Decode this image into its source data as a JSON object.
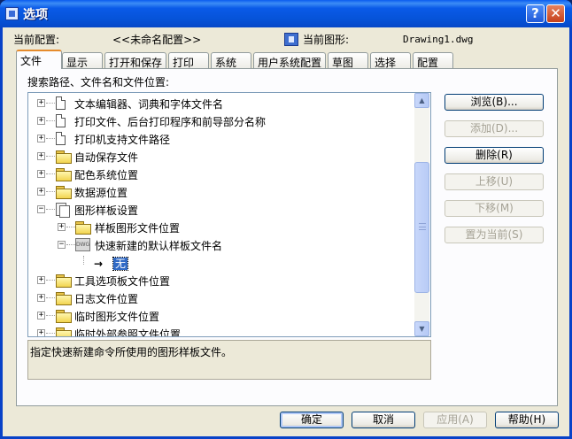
{
  "window": {
    "title": "选项",
    "help_icon": "question-mark-icon",
    "close_icon": "close-x-icon"
  },
  "header": {
    "current_profile_label": "当前配置:",
    "current_profile_value": "<<未命名配置>>",
    "current_drawing_label": "当前图形:",
    "current_drawing_value": "Drawing1.dwg"
  },
  "tabs": [
    {
      "label": "文件",
      "active": true
    },
    {
      "label": "显示",
      "active": false
    },
    {
      "label": "打开和保存",
      "active": false
    },
    {
      "label": "打印",
      "active": false
    },
    {
      "label": "系统",
      "active": false
    },
    {
      "label": "用户系统配置",
      "active": false
    },
    {
      "label": "草图",
      "active": false
    },
    {
      "label": "选择",
      "active": false
    },
    {
      "label": "配置",
      "active": false
    }
  ],
  "files_panel": {
    "heading": "搜索路径、文件名和文件位置:",
    "tree": [
      {
        "label": "文本编辑器、词典和字体文件名",
        "icon": "page-icon",
        "expander": "+"
      },
      {
        "label": "打印文件、后台打印程序和前导部分名称",
        "icon": "page-icon",
        "expander": "+"
      },
      {
        "label": "打印机支持文件路径",
        "icon": "page-icon",
        "expander": "+"
      },
      {
        "label": "自动保存文件",
        "icon": "folder-icon",
        "expander": "+"
      },
      {
        "label": "配色系统位置",
        "icon": "folder-icon",
        "expander": "+"
      },
      {
        "label": "数据源位置",
        "icon": "folder-icon",
        "expander": "+"
      },
      {
        "label": "图形样板设置",
        "icon": "template-icon",
        "expander": "−"
      },
      {
        "label": "样板图形文件位置",
        "icon": "folder-icon",
        "expander": "+"
      },
      {
        "label": "快速新建的默认样板文件名",
        "icon": "dwg-file-icon",
        "expander": "−"
      },
      {
        "label": "无",
        "icon": "arrow-icon",
        "expander": ""
      },
      {
        "label": "工具选项板文件位置",
        "icon": "folder-icon",
        "expander": "+"
      },
      {
        "label": "日志文件位置",
        "icon": "folder-icon",
        "expander": "+"
      },
      {
        "label": "临时图形文件位置",
        "icon": "folder-icon",
        "expander": "+"
      },
      {
        "label": "临时外部参照文件位置",
        "icon": "folder-icon",
        "expander": "+"
      }
    ],
    "description": "指定快速新建命令所使用的图形样板文件。",
    "side_buttons": {
      "browse": "浏览(B)...",
      "add": "添加(D)...",
      "remove": "删除(R)",
      "move_up": "上移(U)",
      "move_down": "下移(M)",
      "set_current": "置为当前(S)"
    }
  },
  "footer": {
    "ok": "确定",
    "cancel": "取消",
    "apply": "应用(A)",
    "help": "帮助(H)"
  },
  "colors": {
    "title_bar": "#0a5ae8",
    "dialog_bg": "#ece9d8",
    "selection": "#316ac5",
    "active_tab_accent": "#e68b2c"
  }
}
